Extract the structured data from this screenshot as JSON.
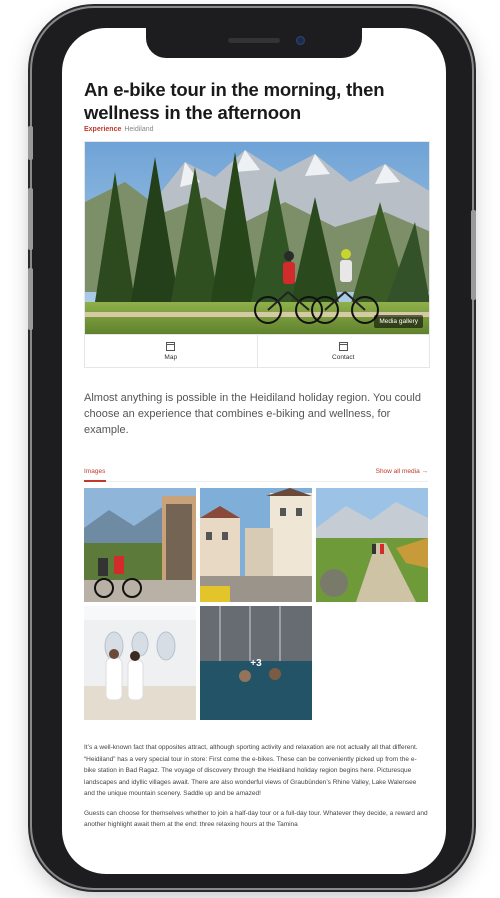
{
  "article": {
    "title_line1": "An e-bike tour in the morning, then",
    "title_line2": "wellness in the afternoon",
    "breadcrumb": [
      "Experience",
      "Heidiland"
    ]
  },
  "hero": {
    "badge": "Media gallery"
  },
  "actions": [
    {
      "label": "Map",
      "icon": "map-icon"
    },
    {
      "label": "Contact",
      "icon": "contact-icon"
    }
  ],
  "intro": "Almost anything is possible in the Heidiland holiday region. You could choose an experience that combines e-biking and wellness, for example.",
  "media": {
    "tab_label": "Images",
    "show_all": "Show all media",
    "more_count": "+3"
  },
  "body": {
    "p1": "It’s a well-known fact that opposites attract, although sporting activity and relaxation are not actually all that different. “Heidiland” has a very special tour in store: First come the e-bikes. These can be conveniently picked up from the e-bike station in Bad Ragaz. The voyage of discovery through the Heidiland holiday region begins here. Picturesque landscapes and idyllic villages await. There are also wonderful views of Graubünden’s Rhine Valley, Lake Walensee and the unique mountain scenery. Saddle up and be amazed!",
    "p2": "Guests can choose for themselves whether to join a half-day tour or a full-day tour. Whatever they decide, a reward and another highlight await them at the end: three relaxing hours at the Tamina"
  },
  "colors": {
    "accent": "#c0392b",
    "text": "#1a1a1a",
    "muted": "#555555",
    "frame": "#1d1d1f"
  }
}
